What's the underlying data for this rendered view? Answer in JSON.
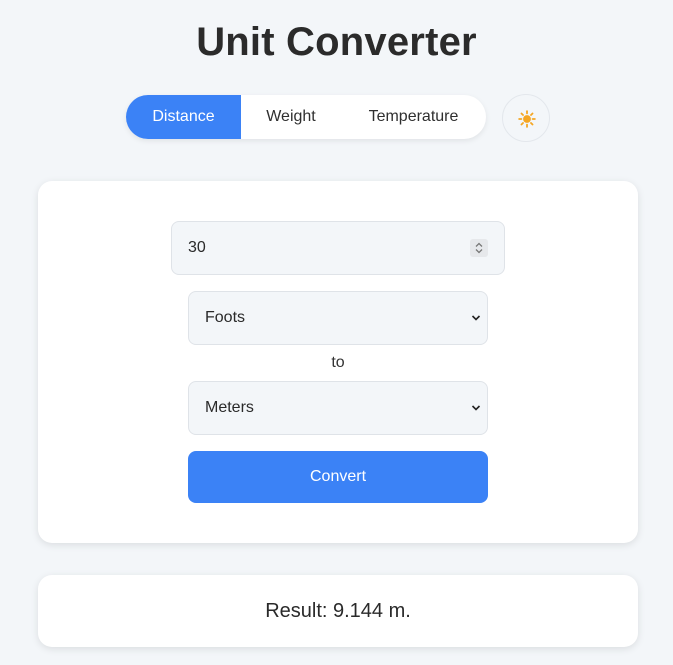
{
  "app": {
    "title": "Unit Converter"
  },
  "tabs": [
    {
      "label": "Distance",
      "active": true
    },
    {
      "label": "Weight",
      "active": false
    },
    {
      "label": "Temperature",
      "active": false
    }
  ],
  "theme_toggle": {
    "icon": "sun-icon"
  },
  "converter": {
    "amount_value": "30",
    "from_unit": "Foots",
    "to_label": "to",
    "to_unit": "Meters",
    "convert_label": "Convert"
  },
  "result": {
    "text": "Result: 9.144 m."
  },
  "colors": {
    "accent": "#3b82f6",
    "background": "#f3f6f9",
    "card": "#ffffff",
    "sun": "#f5a623"
  }
}
